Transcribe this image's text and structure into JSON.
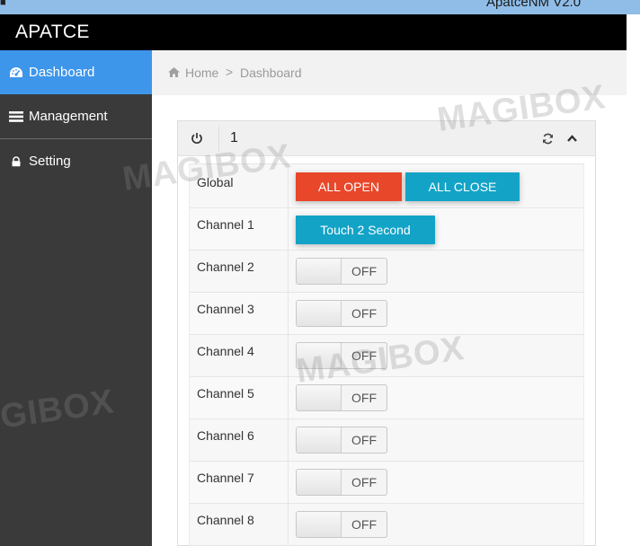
{
  "window": {
    "title": "ApatceNM V2.0"
  },
  "brand": {
    "name": "APATCE"
  },
  "sidebar": {
    "items": [
      {
        "label": "Dashboard",
        "icon": "dashboard-icon",
        "active": true
      },
      {
        "label": "Management",
        "icon": "list-icon",
        "active": false
      },
      {
        "label": "Setting",
        "icon": "lock-icon",
        "active": false
      }
    ]
  },
  "breadcrumb": {
    "home": "Home",
    "separator": ">",
    "current": "Dashboard"
  },
  "panel": {
    "id": "1",
    "global": {
      "label": "Global",
      "open_label": "ALL OPEN",
      "close_label": "ALL CLOSE"
    },
    "channel1": {
      "label": "Channel 1",
      "button_label": "Touch 2 Second"
    },
    "channels": [
      {
        "label": "Channel 2",
        "state": "OFF"
      },
      {
        "label": "Channel 3",
        "state": "OFF"
      },
      {
        "label": "Channel 4",
        "state": "OFF"
      },
      {
        "label": "Channel 5",
        "state": "OFF"
      },
      {
        "label": "Channel 6",
        "state": "OFF"
      },
      {
        "label": "Channel 7",
        "state": "OFF"
      },
      {
        "label": "Channel 8",
        "state": "OFF"
      }
    ]
  },
  "watermarks": [
    "MAGIBOX",
    "MAGIBOX",
    "MAGIBOX",
    "GIBOX"
  ],
  "colors": {
    "active_nav": "#3d96ea",
    "sidebar_bg": "#3a3a3a",
    "all_open": "#e8472a",
    "all_close": "#13a3c7",
    "header_bg": "#000000"
  }
}
